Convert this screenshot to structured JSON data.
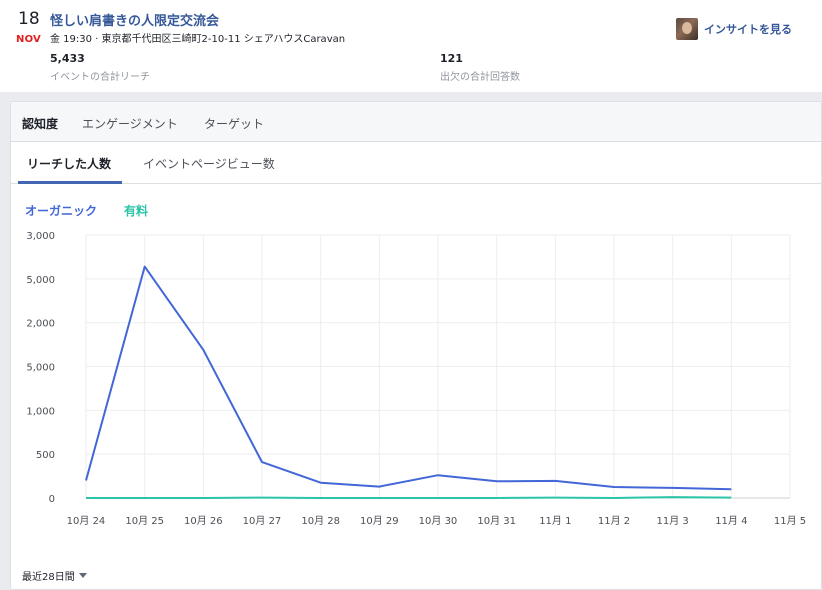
{
  "event": {
    "day": "18",
    "month": "NOV",
    "title": "怪しい肩書きの人限定交流会",
    "meta": "金 19:30 · 東京都千代田区三崎町2-10-11 シェアハウスCaravan",
    "stats": [
      {
        "value": "5,433",
        "label": "イベントの合計リーチ"
      },
      {
        "value": "121",
        "label": "出欠の合計回答数"
      }
    ],
    "insight_label": "インサイトを見る"
  },
  "tabs": {
    "main": [
      "認知度",
      "エンゲージメント",
      "ターゲット"
    ],
    "main_active": 0,
    "sub": [
      "リーチした人数",
      "イベントページビュー数"
    ],
    "sub_active": 0
  },
  "legend": {
    "organic": "オーガニック",
    "paid": "有料"
  },
  "colors": {
    "organic": "#4267d6",
    "paid": "#2bc4a8",
    "link": "#365899",
    "accent": "#4267b2"
  },
  "chart_data": {
    "type": "line",
    "categories": [
      "10月 24",
      "10月 25",
      "10月 26",
      "10月 27",
      "10月 28",
      "10月 29",
      "10月 30",
      "10月 31",
      "11月 1",
      "11月 2",
      "11月 3",
      "11月 4",
      "11月 5"
    ],
    "y_tick_labels": [
      "0",
      "500",
      "1,000",
      "5,000",
      "2,000",
      "5,000",
      "3,000"
    ],
    "series": [
      {
        "name": "オーガニック",
        "values": [
          200,
          2640,
          1690,
          410,
          175,
          130,
          260,
          190,
          195,
          125,
          115,
          100,
          null
        ]
      },
      {
        "name": "有料",
        "values": [
          0,
          0,
          0,
          5,
          0,
          0,
          0,
          0,
          5,
          0,
          10,
          5,
          null
        ]
      }
    ],
    "ylim": [
      0,
      3000
    ],
    "grid": true
  },
  "range_label": "最近28日間"
}
